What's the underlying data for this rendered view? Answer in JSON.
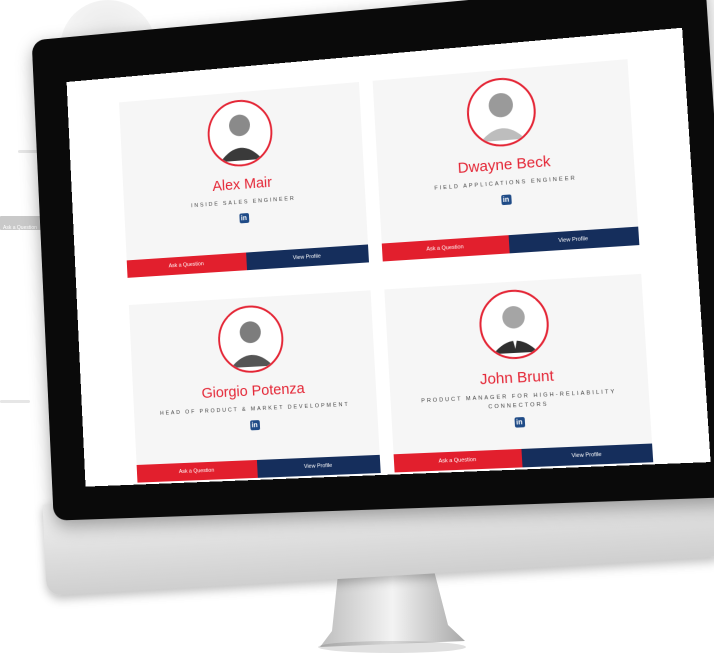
{
  "background": {
    "ghost_button_label": "Ask a Question"
  },
  "monitor": {
    "profiles": [
      {
        "name": "Alex Mair",
        "role": "INSIDE SALES ENGINEER",
        "ask_label": "Ask a Question",
        "view_label": "View Profile",
        "linkedin_icon": "in"
      },
      {
        "name": "Dwayne Beck",
        "role": "FIELD APPLICATIONS ENGINEER",
        "ask_label": "Ask a Question",
        "view_label": "View Profile",
        "linkedin_icon": "in"
      },
      {
        "name": "Giorgio Potenza",
        "role": "HEAD OF PRODUCT & MARKET DEVELOPMENT",
        "ask_label": "Ask a Question",
        "view_label": "View Profile",
        "linkedin_icon": "in"
      },
      {
        "name": "John Brunt",
        "role": "PRODUCT MANAGER FOR HIGH-RELIABILITY CONNECTORS",
        "ask_label": "Ask a Question",
        "view_label": "View Profile",
        "linkedin_icon": "in"
      }
    ]
  },
  "colors": {
    "accent_red": "#e42535",
    "navy": "#152e5c",
    "linkedin": "#1f4b87"
  }
}
